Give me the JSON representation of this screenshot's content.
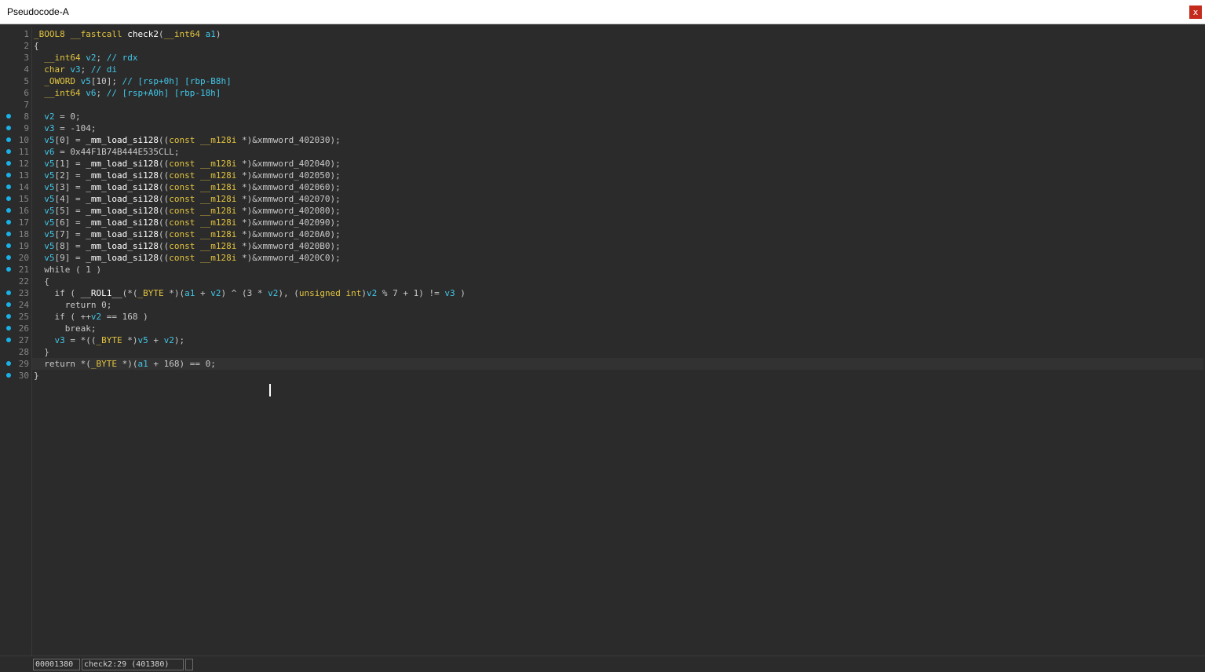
{
  "window": {
    "title": "Pseudocode-A",
    "close_glyph": "x"
  },
  "colors": {
    "background": "#2b2b2b",
    "keyword": "#e2c440",
    "identifier": "#41c7e8",
    "plain": "#c8c8c8",
    "line_number": "#858585",
    "breakpoint": "#18b2e8"
  },
  "code_lines": [
    {
      "num": "1",
      "bp": false,
      "text": "_BOOL8 __fastcall check2(__int64 a1)"
    },
    {
      "num": "2",
      "bp": false,
      "text": "{"
    },
    {
      "num": "3",
      "bp": false,
      "text": "  __int64 v2; // rdx"
    },
    {
      "num": "4",
      "bp": false,
      "text": "  char v3; // di"
    },
    {
      "num": "5",
      "bp": false,
      "text": "  _OWORD v5[10]; // [rsp+0h] [rbp-B8h]"
    },
    {
      "num": "6",
      "bp": false,
      "text": "  __int64 v6; // [rsp+A0h] [rbp-18h]"
    },
    {
      "num": "7",
      "bp": false,
      "text": ""
    },
    {
      "num": "8",
      "bp": true,
      "text": "  v2 = 0;"
    },
    {
      "num": "9",
      "bp": true,
      "text": "  v3 = -104;"
    },
    {
      "num": "10",
      "bp": true,
      "text": "  v5[0] = _mm_load_si128((const __m128i *)&xmmword_402030);"
    },
    {
      "num": "11",
      "bp": true,
      "text": "  v6 = 0x44F1B74B444E535CLL;"
    },
    {
      "num": "12",
      "bp": true,
      "text": "  v5[1] = _mm_load_si128((const __m128i *)&xmmword_402040);"
    },
    {
      "num": "13",
      "bp": true,
      "text": "  v5[2] = _mm_load_si128((const __m128i *)&xmmword_402050);"
    },
    {
      "num": "14",
      "bp": true,
      "text": "  v5[3] = _mm_load_si128((const __m128i *)&xmmword_402060);"
    },
    {
      "num": "15",
      "bp": true,
      "text": "  v5[4] = _mm_load_si128((const __m128i *)&xmmword_402070);"
    },
    {
      "num": "16",
      "bp": true,
      "text": "  v5[5] = _mm_load_si128((const __m128i *)&xmmword_402080);"
    },
    {
      "num": "17",
      "bp": true,
      "text": "  v5[6] = _mm_load_si128((const __m128i *)&xmmword_402090);"
    },
    {
      "num": "18",
      "bp": true,
      "text": "  v5[7] = _mm_load_si128((const __m128i *)&xmmword_4020A0);"
    },
    {
      "num": "19",
      "bp": true,
      "text": "  v5[8] = _mm_load_si128((const __m128i *)&xmmword_4020B0);"
    },
    {
      "num": "20",
      "bp": true,
      "text": "  v5[9] = _mm_load_si128((const __m128i *)&xmmword_4020C0);"
    },
    {
      "num": "21",
      "bp": true,
      "text": "  while ( 1 )"
    },
    {
      "num": "22",
      "bp": false,
      "text": "  {"
    },
    {
      "num": "23",
      "bp": true,
      "text": "    if ( __ROL1__(*(_BYTE *)(a1 + v2) ^ (3 * v2), (unsigned int)v2 % 7 + 1) != v3 )"
    },
    {
      "num": "24",
      "bp": true,
      "text": "      return 0;"
    },
    {
      "num": "25",
      "bp": true,
      "text": "    if ( ++v2 == 168 )"
    },
    {
      "num": "26",
      "bp": true,
      "text": "      break;"
    },
    {
      "num": "27",
      "bp": true,
      "text": "    v3 = *((_BYTE *)v5 + v2);"
    },
    {
      "num": "28",
      "bp": false,
      "text": "  }"
    },
    {
      "num": "29",
      "bp": true,
      "text": "  return *(_BYTE *)(a1 + 168) == 0;"
    },
    {
      "num": "30",
      "bp": true,
      "text": "}"
    }
  ],
  "status": {
    "address": "00001380",
    "location": "check2:29 (401380)"
  }
}
